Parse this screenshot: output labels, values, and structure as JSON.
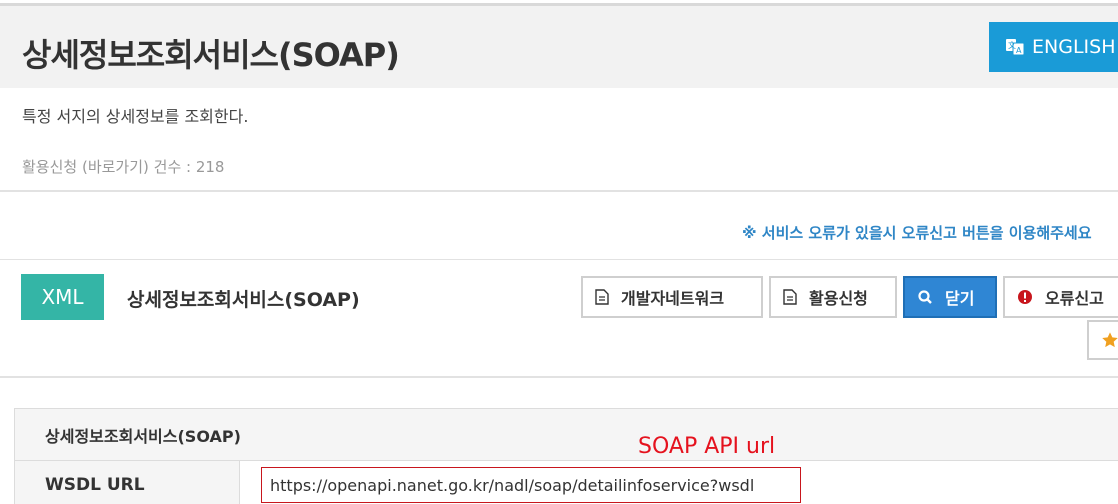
{
  "header": {
    "title": "상세정보조회서비스(SOAP)",
    "english_label": "ENGLISH"
  },
  "description": "특정 서지의 상세정보를 조회한다.",
  "usage": {
    "link_label": "활용신청 (바로가기)",
    "count_text": "건수 : 218"
  },
  "notice": "※ 서비스 오류가 있을시 오류신고 버튼을 이용해주세요",
  "service": {
    "badge": "XML",
    "title": "상세정보조회서비스(SOAP)"
  },
  "buttons": {
    "dev_network": "개발자네트워크",
    "apply": "활용신청",
    "close": "닫기",
    "error_report": "오류신고"
  },
  "panel": {
    "header": "상세정보조회서비스(SOAP)",
    "wsdl_label": "WSDL URL",
    "wsdl_value": "https://openapi.nanet.go.kr/nadl/soap/detailinfoservice?wsdl"
  },
  "annotation": "SOAP API url",
  "colors": {
    "accent_blue": "#1a9bd7",
    "xml_badge": "#34b5a6",
    "close_button": "#2f86d4",
    "error_icon": "#c8161d",
    "star": "#f0a020",
    "annotation": "#e5121e"
  }
}
